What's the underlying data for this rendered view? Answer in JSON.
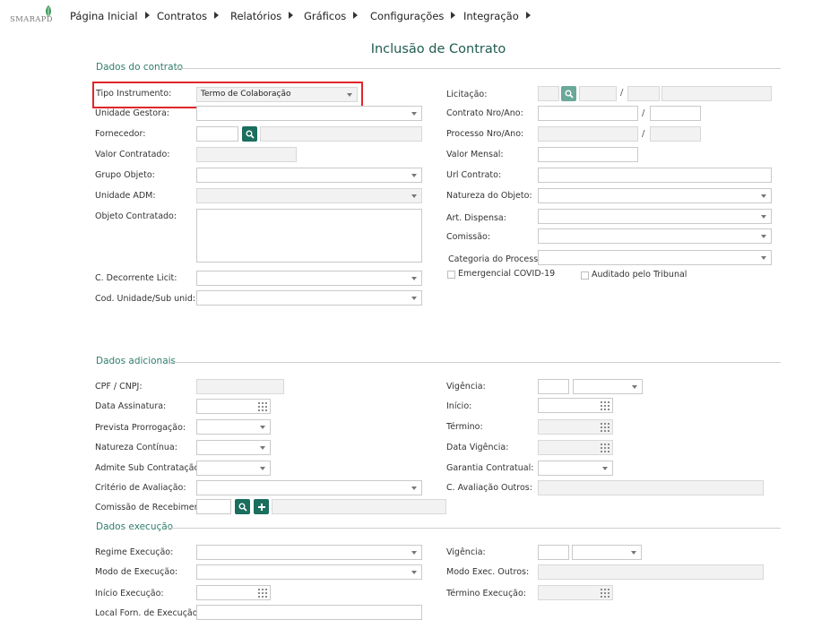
{
  "app": {
    "logo_text": "SMARAPD",
    "nav": [
      "Página Inicial",
      "Contratos",
      "Relatórios",
      "Gráficos",
      "Configurações",
      "Integração"
    ]
  },
  "page_title": "Inclusão de Contrato",
  "sections": {
    "dados_contrato": "Dados do contrato",
    "dados_adicionais": "Dados adicionais",
    "dados_execucao": "Dados execução"
  },
  "contrato": {
    "tipo_instrumento": {
      "label": "Tipo Instrumento:",
      "value": "Termo de Colaboração"
    },
    "unidade_gestora": "Unidade Gestora:",
    "fornecedor": "Fornecedor:",
    "valor_contratado": "Valor Contratado:",
    "grupo_objeto": "Grupo Objeto:",
    "unidade_adm": "Unidade ADM:",
    "objeto_contratado": "Objeto Contratado:",
    "c_decorrente_licit": "C. Decorrente Licit:",
    "cod_unidade": "Cod. Unidade/Sub unid:",
    "licitacao": "Licitação:",
    "contrato_nro_ano": "Contrato Nro/Ano:",
    "processo_nro_ano": "Processo Nro/Ano:",
    "valor_mensal": "Valor Mensal:",
    "url_contrato": "Url Contrato:",
    "natureza_objeto": "Natureza do Objeto:",
    "art_dispensa": "Art. Dispensa:",
    "comissao": "Comissão:",
    "categoria_processo": "Categoria do Processo:",
    "emergencial_covid": "Emergencial COVID-19",
    "auditado_tribunal": "Auditado pelo Tribunal",
    "slash": "/"
  },
  "adicionais": {
    "cpf_cnpj": "CPF / CNPJ:",
    "data_assinatura": "Data Assinatura:",
    "prevista_prorrogacao": "Prevista Prorrogação:",
    "natureza_continua": "Natureza Contínua:",
    "admite_sub": "Admite Sub Contratação:",
    "criterio_avaliacao": "Critério de Avaliação:",
    "comissao_recebimento": "Comissão de Recebimento:",
    "vigencia": "Vigência:",
    "inicio": "Início:",
    "termino": "Término:",
    "data_vigencia": "Data Vigência:",
    "garantia_contratual": "Garantia Contratual:",
    "c_avaliacao_outros": "C. Avaliação Outros:"
  },
  "execucao": {
    "regime_execucao": "Regime Execução:",
    "modo_execucao": "Modo de Execução:",
    "inicio_execucao": "Início Execução:",
    "local_forn": "Local Forn. de Execução:",
    "vigencia": "Vigência:",
    "modo_exec_outros": "Modo Exec. Outros:",
    "termino_execucao": "Término Execução:"
  },
  "colors": {
    "accent": "#1a6e5d",
    "section_title": "#2f7d6b",
    "highlight": "#e0262b"
  }
}
